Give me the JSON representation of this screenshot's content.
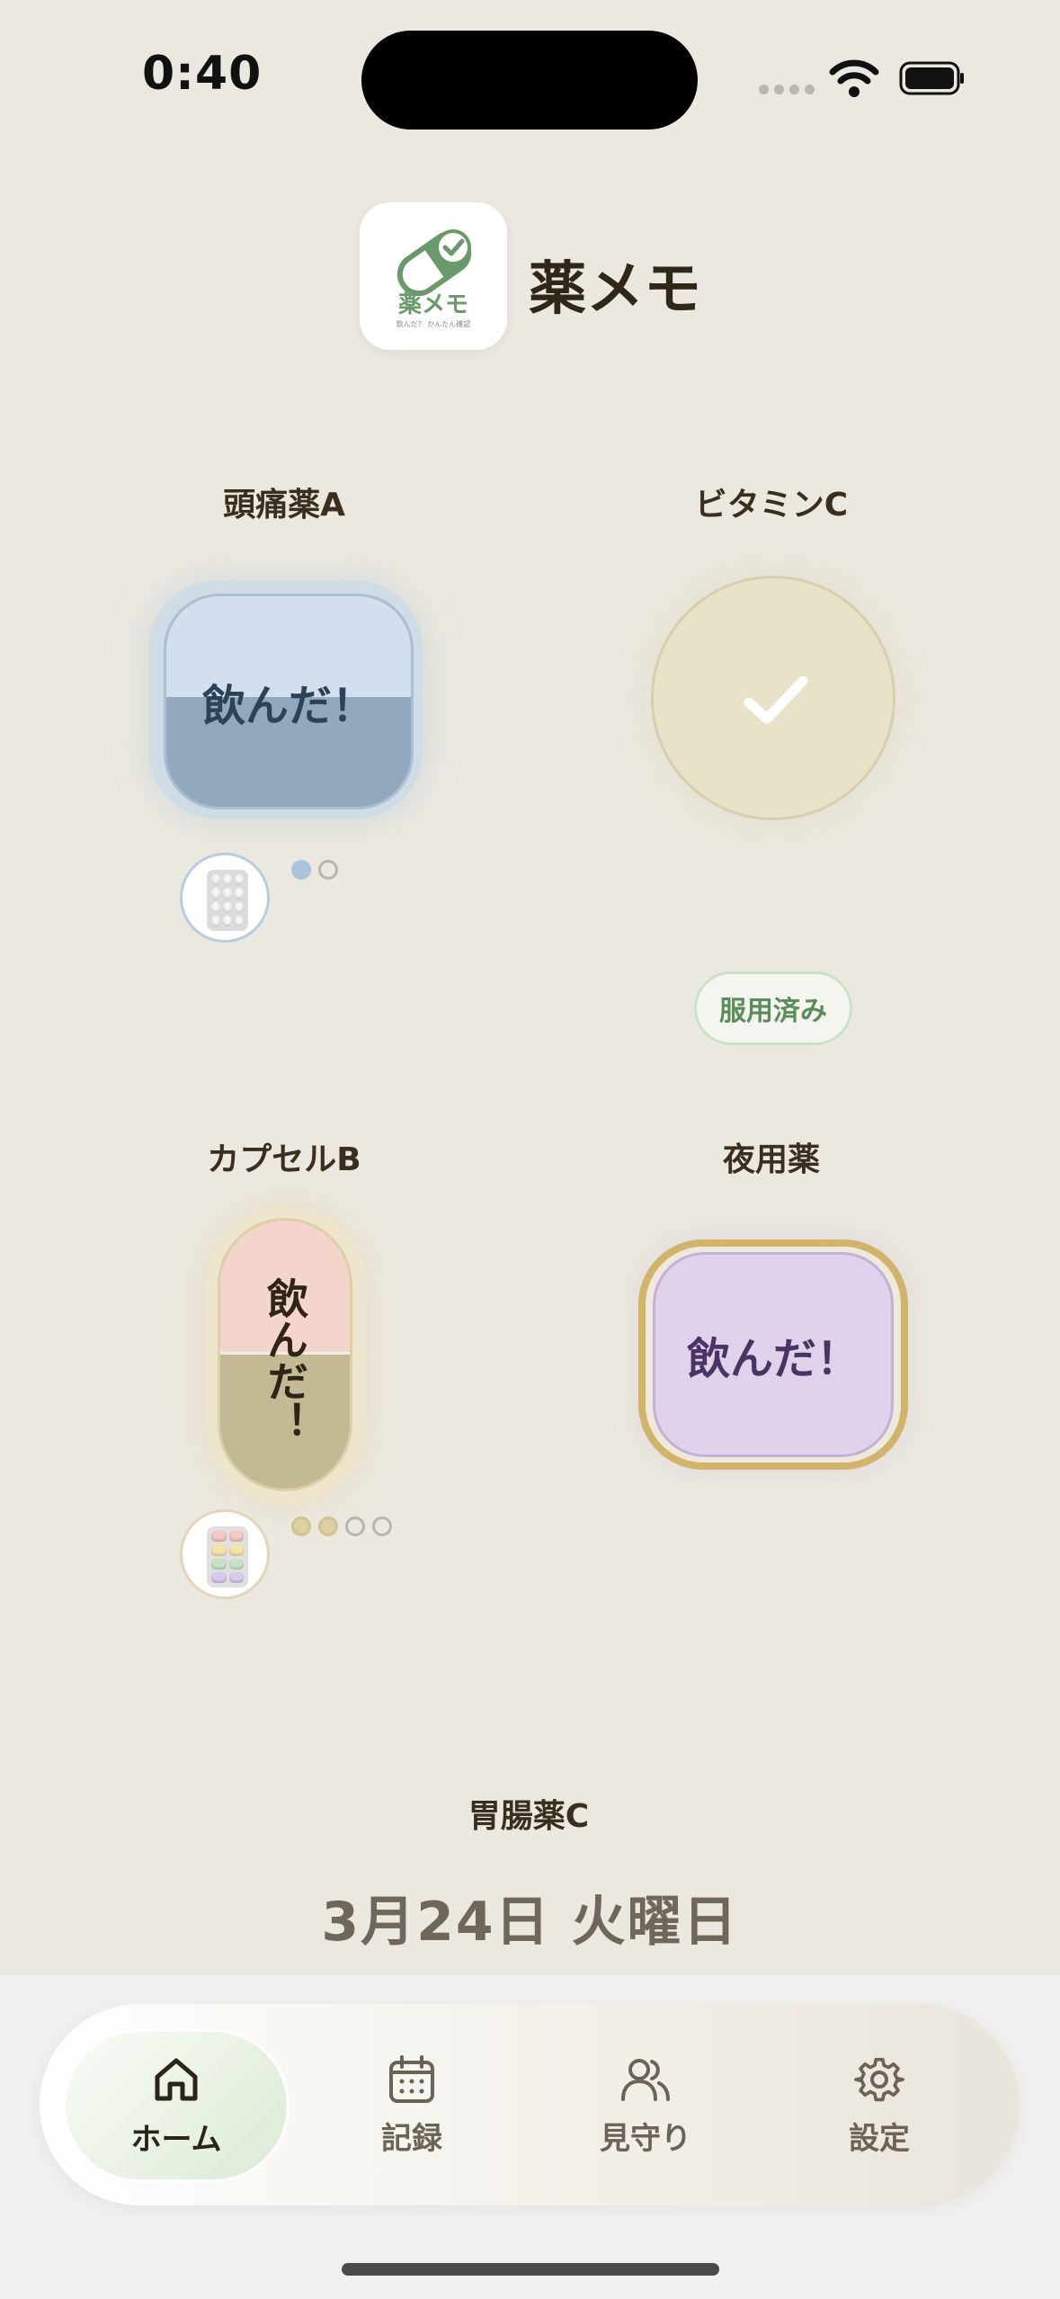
{
  "status_bar": {
    "time": "0:40"
  },
  "header": {
    "logo_text": "薬メモ",
    "logo_subtext": "飲んだ？ かんたん確認",
    "title": "薬メモ"
  },
  "meds": [
    {
      "name": "頭痛薬A",
      "button_label": "飲んだ！",
      "dose_count": 2,
      "doses_taken": 1
    },
    {
      "name": "ビタミンC",
      "status_badge": "服用済み"
    },
    {
      "name": "カプセルB",
      "button_label": "飲んだ！",
      "dose_count": 4,
      "doses_taken": 2
    },
    {
      "name": "夜用薬",
      "button_label": "飲んだ！"
    },
    {
      "name": "胃腸薬C"
    }
  ],
  "date_text": "3月24日 火曜日",
  "tabs": [
    {
      "label": "ホーム",
      "icon": "home-icon",
      "active": true
    },
    {
      "label": "記録",
      "icon": "calendar-icon",
      "active": false
    },
    {
      "label": "見守り",
      "icon": "people-icon",
      "active": false
    },
    {
      "label": "設定",
      "icon": "gear-icon",
      "active": false
    }
  ],
  "colors": {
    "background": "#ebe8df",
    "accent_green": "#6a9a6a",
    "med_a": "#d1e0ec",
    "med_b": "#f4d5cb",
    "night": "#e0d2ea",
    "gold_ring": "#d1b46a"
  }
}
